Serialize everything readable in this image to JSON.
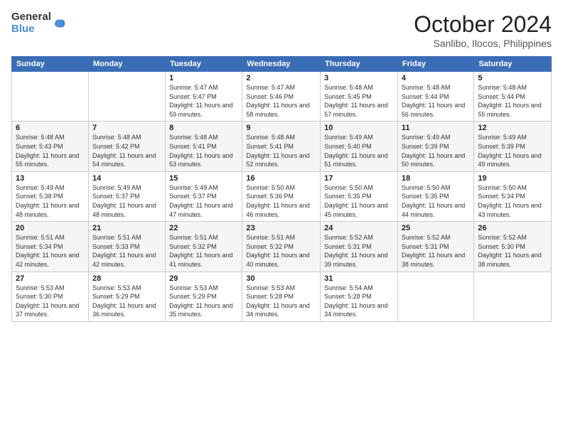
{
  "logo": {
    "line1": "General",
    "line2": "Blue"
  },
  "title": "October 2024",
  "location": "Sanlibo, Ilocos, Philippines",
  "days_header": [
    "Sunday",
    "Monday",
    "Tuesday",
    "Wednesday",
    "Thursday",
    "Friday",
    "Saturday"
  ],
  "weeks": [
    [
      {
        "num": "",
        "info": ""
      },
      {
        "num": "",
        "info": ""
      },
      {
        "num": "1",
        "info": "Sunrise: 5:47 AM\nSunset: 5:47 PM\nDaylight: 11 hours and 59 minutes."
      },
      {
        "num": "2",
        "info": "Sunrise: 5:47 AM\nSunset: 5:46 PM\nDaylight: 11 hours and 58 minutes."
      },
      {
        "num": "3",
        "info": "Sunrise: 5:48 AM\nSunset: 5:45 PM\nDaylight: 11 hours and 57 minutes."
      },
      {
        "num": "4",
        "info": "Sunrise: 5:48 AM\nSunset: 5:44 PM\nDaylight: 11 hours and 56 minutes."
      },
      {
        "num": "5",
        "info": "Sunrise: 5:48 AM\nSunset: 5:44 PM\nDaylight: 11 hours and 55 minutes."
      }
    ],
    [
      {
        "num": "6",
        "info": "Sunrise: 5:48 AM\nSunset: 5:43 PM\nDaylight: 11 hours and 55 minutes."
      },
      {
        "num": "7",
        "info": "Sunrise: 5:48 AM\nSunset: 5:42 PM\nDaylight: 11 hours and 54 minutes."
      },
      {
        "num": "8",
        "info": "Sunrise: 5:48 AM\nSunset: 5:41 PM\nDaylight: 11 hours and 53 minutes."
      },
      {
        "num": "9",
        "info": "Sunrise: 5:48 AM\nSunset: 5:41 PM\nDaylight: 11 hours and 52 minutes."
      },
      {
        "num": "10",
        "info": "Sunrise: 5:49 AM\nSunset: 5:40 PM\nDaylight: 11 hours and 51 minutes."
      },
      {
        "num": "11",
        "info": "Sunrise: 5:49 AM\nSunset: 5:39 PM\nDaylight: 11 hours and 50 minutes."
      },
      {
        "num": "12",
        "info": "Sunrise: 5:49 AM\nSunset: 5:39 PM\nDaylight: 11 hours and 49 minutes."
      }
    ],
    [
      {
        "num": "13",
        "info": "Sunrise: 5:49 AM\nSunset: 5:38 PM\nDaylight: 11 hours and 48 minutes."
      },
      {
        "num": "14",
        "info": "Sunrise: 5:49 AM\nSunset: 5:37 PM\nDaylight: 11 hours and 48 minutes."
      },
      {
        "num": "15",
        "info": "Sunrise: 5:49 AM\nSunset: 5:37 PM\nDaylight: 11 hours and 47 minutes."
      },
      {
        "num": "16",
        "info": "Sunrise: 5:50 AM\nSunset: 5:36 PM\nDaylight: 11 hours and 46 minutes."
      },
      {
        "num": "17",
        "info": "Sunrise: 5:50 AM\nSunset: 5:35 PM\nDaylight: 11 hours and 45 minutes."
      },
      {
        "num": "18",
        "info": "Sunrise: 5:50 AM\nSunset: 5:35 PM\nDaylight: 11 hours and 44 minutes."
      },
      {
        "num": "19",
        "info": "Sunrise: 5:50 AM\nSunset: 5:34 PM\nDaylight: 11 hours and 43 minutes."
      }
    ],
    [
      {
        "num": "20",
        "info": "Sunrise: 5:51 AM\nSunset: 5:34 PM\nDaylight: 11 hours and 42 minutes."
      },
      {
        "num": "21",
        "info": "Sunrise: 5:51 AM\nSunset: 5:33 PM\nDaylight: 11 hours and 42 minutes."
      },
      {
        "num": "22",
        "info": "Sunrise: 5:51 AM\nSunset: 5:32 PM\nDaylight: 11 hours and 41 minutes."
      },
      {
        "num": "23",
        "info": "Sunrise: 5:51 AM\nSunset: 5:32 PM\nDaylight: 11 hours and 40 minutes."
      },
      {
        "num": "24",
        "info": "Sunrise: 5:52 AM\nSunset: 5:31 PM\nDaylight: 11 hours and 39 minutes."
      },
      {
        "num": "25",
        "info": "Sunrise: 5:52 AM\nSunset: 5:31 PM\nDaylight: 11 hours and 38 minutes."
      },
      {
        "num": "26",
        "info": "Sunrise: 5:52 AM\nSunset: 5:30 PM\nDaylight: 11 hours and 38 minutes."
      }
    ],
    [
      {
        "num": "27",
        "info": "Sunrise: 5:53 AM\nSunset: 5:30 PM\nDaylight: 11 hours and 37 minutes."
      },
      {
        "num": "28",
        "info": "Sunrise: 5:53 AM\nSunset: 5:29 PM\nDaylight: 11 hours and 36 minutes."
      },
      {
        "num": "29",
        "info": "Sunrise: 5:53 AM\nSunset: 5:29 PM\nDaylight: 11 hours and 35 minutes."
      },
      {
        "num": "30",
        "info": "Sunrise: 5:53 AM\nSunset: 5:28 PM\nDaylight: 11 hours and 34 minutes."
      },
      {
        "num": "31",
        "info": "Sunrise: 5:54 AM\nSunset: 5:28 PM\nDaylight: 11 hours and 34 minutes."
      },
      {
        "num": "",
        "info": ""
      },
      {
        "num": "",
        "info": ""
      }
    ]
  ]
}
